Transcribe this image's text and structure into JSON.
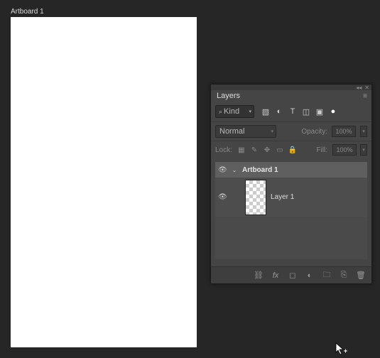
{
  "canvas": {
    "label": "Artboard 1"
  },
  "panel": {
    "title": "Layers",
    "filter": {
      "kind": "Kind"
    },
    "mode": "Normal",
    "opacity_label": "Opacity:",
    "opacity_value": "100%",
    "fill_label": "Fill:",
    "fill_value": "100%",
    "lock_label": "Lock:",
    "artboard": {
      "name": "Artboard 1"
    },
    "layer": {
      "name": "Layer 1"
    }
  }
}
